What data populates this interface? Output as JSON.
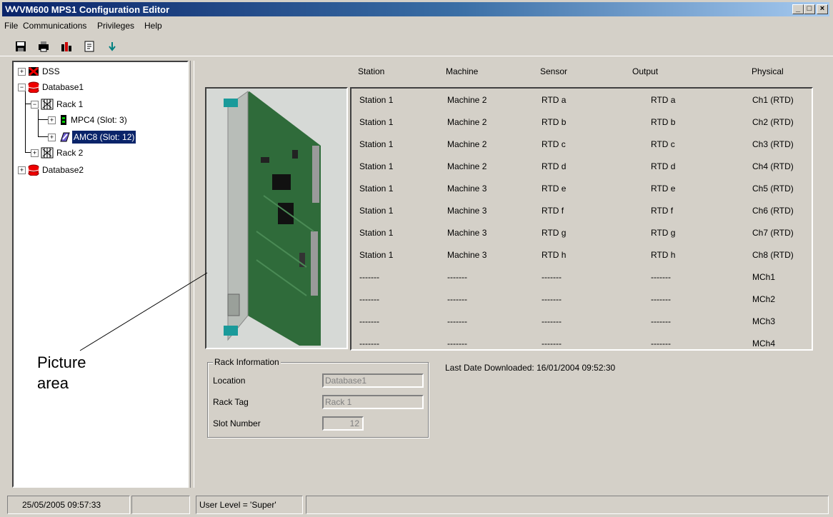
{
  "window": {
    "title": "VM600 MPS1 Configuration Editor",
    "logo": "VVV"
  },
  "menu": [
    "File",
    "Communications",
    "Privileges",
    "Help"
  ],
  "toolbar": {
    "icons": [
      "save-icon",
      "print-icon",
      "chart-icon",
      "document-icon",
      "download-icon"
    ]
  },
  "tree": {
    "nodes": [
      {
        "label": "DSS",
        "icon": "dss-icon"
      },
      {
        "label": "Database1",
        "icon": "database-icon"
      },
      {
        "label": "Rack 1",
        "icon": "rack-icon"
      },
      {
        "label": "MPC4 (Slot:  3)",
        "icon": "card-icon"
      },
      {
        "label": "AMC8 (Slot: 12)",
        "icon": "card-icon",
        "selected": true
      },
      {
        "label": "Rack 2",
        "icon": "rack-icon"
      },
      {
        "label": "Database2",
        "icon": "database-icon"
      }
    ]
  },
  "table": {
    "headers": [
      "Station",
      "Machine",
      "Sensor",
      "Output",
      "Physical"
    ],
    "rows": [
      [
        "Station 1",
        "Machine 2",
        "RTD a",
        "RTD a",
        "Ch1 (RTD)"
      ],
      [
        "Station 1",
        "Machine 2",
        "RTD b",
        "RTD b",
        "Ch2 (RTD)"
      ],
      [
        "Station 1",
        "Machine 2",
        "RTD c",
        "RTD c",
        "Ch3 (RTD)"
      ],
      [
        "Station 1",
        "Machine 2",
        "RTD d",
        "RTD d",
        "Ch4 (RTD)"
      ],
      [
        "Station 1",
        "Machine 3",
        "RTD e",
        "RTD e",
        "Ch5 (RTD)"
      ],
      [
        "Station 1",
        "Machine 3",
        "RTD f",
        "RTD f",
        "Ch6 (RTD)"
      ],
      [
        "Station 1",
        "Machine 3",
        "RTD g",
        "RTD g",
        "Ch7 (RTD)"
      ],
      [
        "Station 1",
        "Machine 3",
        "RTD h",
        "RTD h",
        "Ch8 (RTD)"
      ],
      [
        "-------",
        "-------",
        "-------",
        "-------",
        "MCh1"
      ],
      [
        "-------",
        "-------",
        "-------",
        "-------",
        "MCh2"
      ],
      [
        "-------",
        "-------",
        "-------",
        "-------",
        "MCh3"
      ],
      [
        "-------",
        "-------",
        "-------",
        "-------",
        "MCh4"
      ]
    ]
  },
  "rack_info": {
    "legend": "Rack Information",
    "location_label": "Location",
    "location_value": "Database1",
    "rack_tag_label": "Rack Tag",
    "rack_tag_value": "Rack 1",
    "slot_label": "Slot Number",
    "slot_value": "12"
  },
  "last_download": {
    "label": "Last Date Downloaded:",
    "value": "16/01/2004  09:52:30"
  },
  "annotation": {
    "line1": "Picture",
    "line2": "area"
  },
  "status": {
    "datetime": "25/05/2005  09:57:33",
    "user_level": "User Level = 'Super'"
  }
}
